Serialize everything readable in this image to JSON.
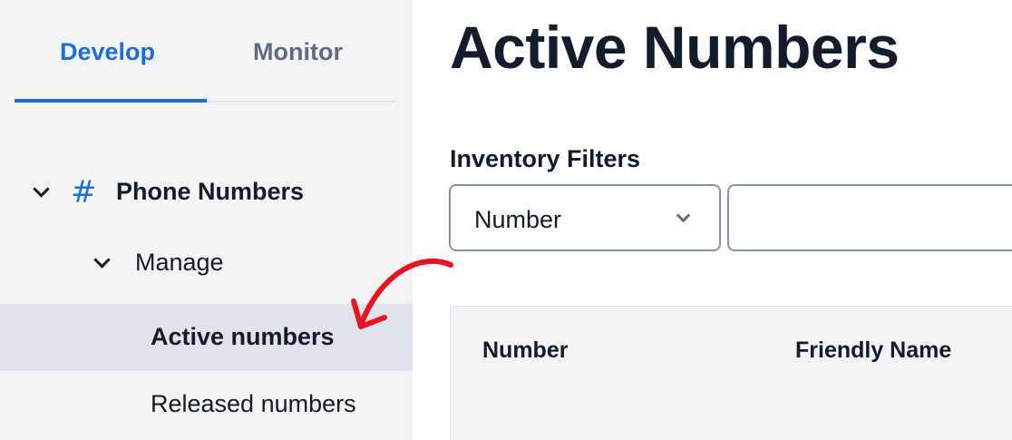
{
  "tabs": [
    {
      "label": "Develop",
      "active": true
    },
    {
      "label": "Monitor",
      "active": false
    }
  ],
  "sidebar": {
    "section": {
      "label": "Phone Numbers",
      "icon": "hash-icon",
      "expanded": true
    },
    "group": {
      "label": "Manage",
      "expanded": true
    },
    "items": [
      {
        "label": "Active numbers",
        "selected": true
      },
      {
        "label": "Released numbers",
        "selected": false
      }
    ]
  },
  "main": {
    "title": "Active Numbers",
    "filters": {
      "label": "Inventory Filters",
      "select_value": "Number",
      "search_value": ""
    },
    "table": {
      "columns": [
        "Number",
        "Friendly Name"
      ]
    }
  },
  "colors": {
    "accent": "#1f6ed4",
    "annotation": "#e8141f",
    "sidebar_bg": "#f4f4f6",
    "selected_bg": "#e1e3ea"
  }
}
